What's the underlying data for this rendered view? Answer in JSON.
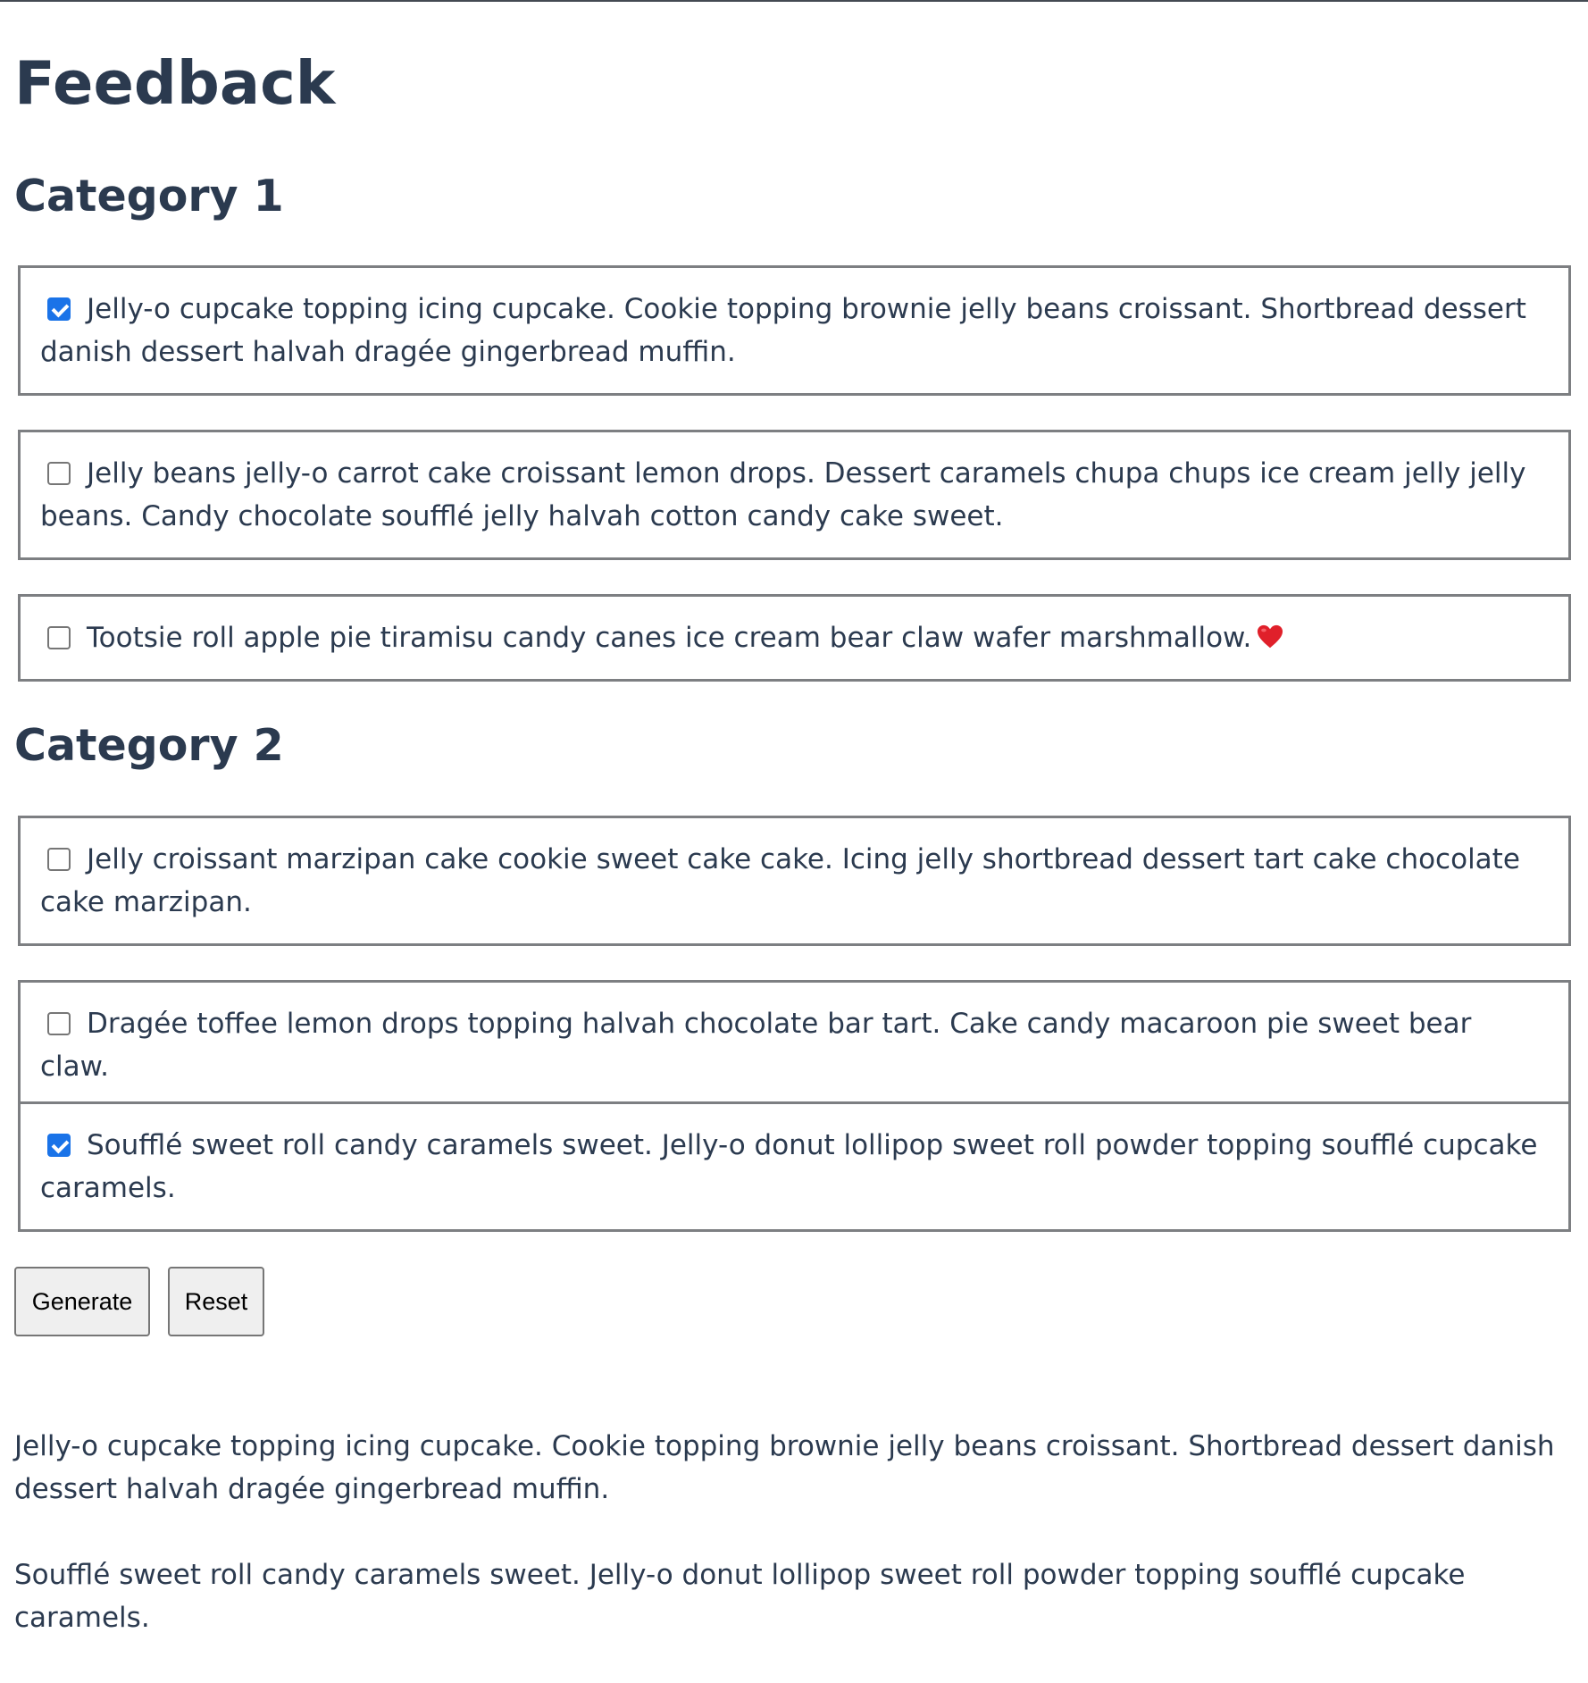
{
  "title": "Feedback",
  "categories": [
    {
      "heading": "Category 1",
      "options": [
        {
          "checked": true,
          "text": "Jelly-o cupcake topping icing cupcake. Cookie topping brownie jelly beans croissant. Shortbread dessert danish dessert halvah dragée gingerbread muffin."
        },
        {
          "checked": false,
          "text": "Jelly beans jelly-o carrot cake croissant lemon drops. Dessert caramels chupa chups ice cream jelly jelly beans. Candy chocolate soufflé jelly halvah cotton candy cake sweet."
        },
        {
          "checked": false,
          "text": "Tootsie roll apple pie tiramisu candy canes ice cream bear claw wafer marshmallow.",
          "icon": "heart-icon"
        }
      ]
    },
    {
      "heading": "Category 2",
      "options": [
        {
          "checked": false,
          "text": "Jelly croissant marzipan cake cookie sweet cake cake. Icing jelly shortbread dessert tart cake chocolate cake marzipan."
        },
        {
          "checked": false,
          "text": "Dragée toffee lemon drops topping halvah chocolate bar tart. Cake candy macaroon pie sweet bear claw."
        },
        {
          "checked": true,
          "text": "Soufflé sweet roll candy caramels sweet. Jelly-o donut lollipop sweet roll powder topping soufflé cupcake caramels."
        }
      ]
    }
  ],
  "buttons": {
    "generate": "Generate",
    "reset": "Reset"
  },
  "output": [
    "Jelly-o cupcake topping icing cupcake. Cookie topping brownie jelly beans croissant. Shortbread dessert danish dessert halvah dragée gingerbread muffin.",
    "Soufflé sweet roll candy caramels sweet. Jelly-o donut lollipop sweet roll powder topping soufflé cupcake caramels."
  ],
  "colors": {
    "text": "#2b3a4f",
    "checkbox_checked": "#1a73e8",
    "option_border": "#7d7f82",
    "button_bg": "#efefef",
    "heart": "#e0202a"
  }
}
